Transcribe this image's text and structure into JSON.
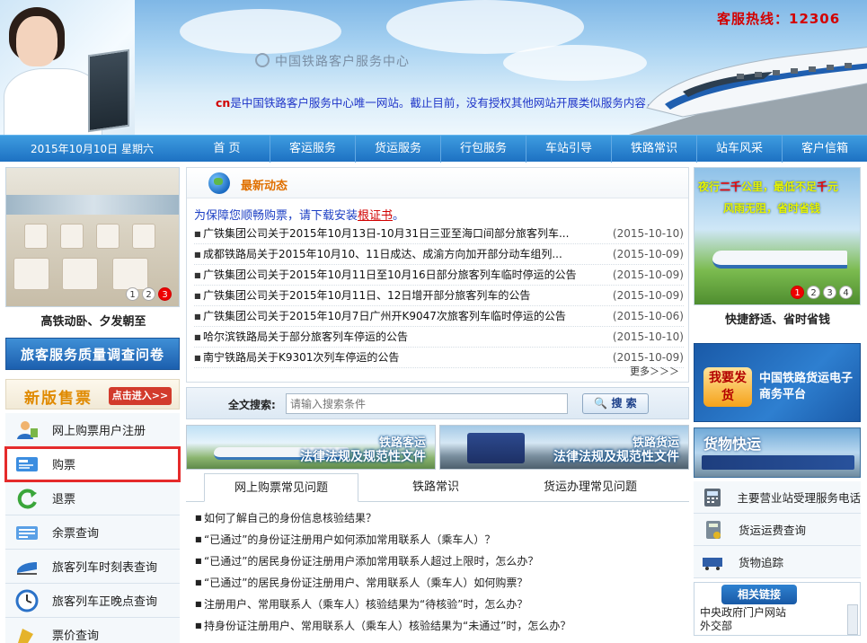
{
  "header": {
    "logo_text": "中国铁路客户服务中心",
    "notice_prefix": "cn",
    "notice": "是中国铁路客户服务中心唯一网站。截止目前，没有授权其他网站开展类似服务内容，敬请广大用户注意",
    "hotline": "客服热线：12306"
  },
  "nav": {
    "date": "2015年10月10日 星期六",
    "items": [
      "首 页",
      "客运服务",
      "货运服务",
      "行包服务",
      "车站引导",
      "铁路常识",
      "站车风采",
      "客户信箱"
    ]
  },
  "left": {
    "slide_caption": "高铁动卧、夕发朝至",
    "slide_dots": [
      "1",
      "2",
      "3"
    ],
    "survey": "旅客服务质量调查问卷",
    "new_version": "新版售票",
    "enter": "点击进入>>",
    "menu": [
      {
        "label": "网上购票用户注册",
        "icon": "user-register-icon"
      },
      {
        "label": "购票",
        "icon": "ticket-icon"
      },
      {
        "label": "退票",
        "icon": "refund-icon"
      },
      {
        "label": "余票查询",
        "icon": "remaining-ticket-icon"
      },
      {
        "label": "旅客列车时刻表查询",
        "icon": "train-schedule-icon"
      },
      {
        "label": "旅客列车正晚点查询",
        "icon": "clock-icon"
      },
      {
        "label": "票价查询",
        "icon": "price-icon"
      }
    ]
  },
  "news": {
    "title": "最新动态",
    "cert_prefix": "为保障您顺畅购票，请下载安装",
    "cert_link": "根证书",
    "cert_suffix": "。",
    "items": [
      {
        "title": "广铁集团公司关于2015年10月13日-10月31日三亚至海口间部分旅客列车...",
        "date": "(2015-10-10)"
      },
      {
        "title": "成都铁路局关于2015年10月10、11日成达、成渝方向加开部分动车组列...",
        "date": "(2015-10-09)"
      },
      {
        "title": "广铁集团公司关于2015年10月11日至10月16日部分旅客列车临时停运的公告",
        "date": "(2015-10-09)"
      },
      {
        "title": "广铁集团公司关于2015年10月11日、12日增开部分旅客列车的公告",
        "date": "(2015-10-09)"
      },
      {
        "title": "广铁集团公司关于2015年10月7日广州开K9047次旅客列车临时停运的公告",
        "date": "(2015-10-06)"
      },
      {
        "title": "哈尔滨铁路局关于部分旅客列车停运的公告",
        "date": "(2015-10-10)"
      },
      {
        "title": "南宁铁路局关于K9301次列车停运的公告",
        "date": "(2015-10-09)"
      }
    ],
    "more": "更多＞＞＞"
  },
  "search": {
    "label": "全文搜索:",
    "placeholder": "请输入搜索条件",
    "button": "搜 索"
  },
  "laws": [
    {
      "tag": "铁路客运",
      "title": "法律法规及规范性文件"
    },
    {
      "tag": "铁路货运",
      "title": "法律法规及规范性文件"
    }
  ],
  "tabs": [
    "网上购票常见问题",
    "铁路常识",
    "货运办理常见问题"
  ],
  "faq": [
    "如何了解自己的身份信息核验结果？",
    "“已通过”的身份证注册用户如何添加常用联系人（乘车人）？",
    "“已通过”的居民身份证注册用户添加常用联系人超过上限时，怎么办？",
    "“已通过”的居民身份证注册用户、常用联系人（乘车人）如何购票？",
    "注册用户、常用联系人（乘车人）核验结果为“待核验”时，怎么办？",
    "持身份证注册用户、常用联系人（乘车人）核验结果为“未通过”时，怎么办？"
  ],
  "right": {
    "slogan_a": "夜行",
    "slogan_b": "二千",
    "slogan_c": "公里，最低不足",
    "slogan_d": "千",
    "slogan_e": "元",
    "slogan2": "风雨无阻，省时省钱",
    "slide_dots": [
      "1",
      "2",
      "3",
      "4"
    ],
    "slide_caption": "快捷舒适、省时省钱",
    "cargo_button": "我要发货",
    "cargo_text": "中国铁路货运电子商务平台",
    "express": "货物快运",
    "list": [
      {
        "label": "主要营业站受理服务电话",
        "icon": "phone-icon"
      },
      {
        "label": "货运运费查询",
        "icon": "calculator-icon"
      },
      {
        "label": "货物追踪",
        "icon": "cargo-track-icon"
      }
    ],
    "links_title": "相关链接",
    "links": [
      "中央政府门户网站",
      "外交部"
    ]
  },
  "colors": {
    "accent": "#1d71c2",
    "highlight": "#e52b2b",
    "news_title": "#e07000"
  }
}
